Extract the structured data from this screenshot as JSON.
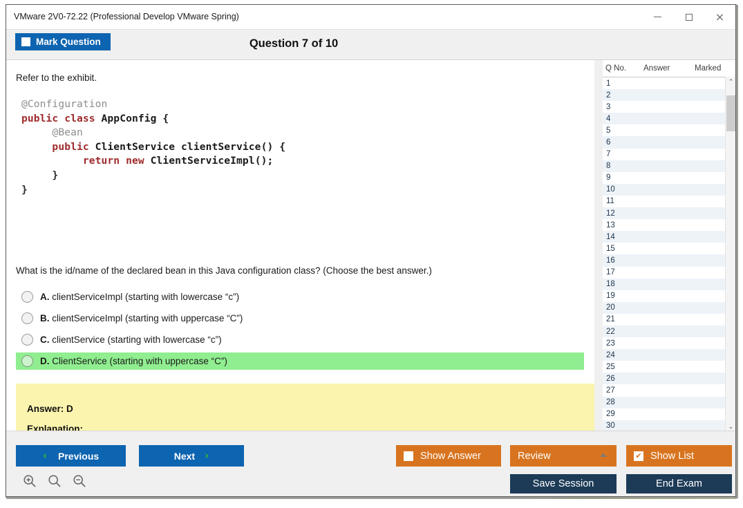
{
  "window": {
    "title": "VMware 2V0-72.22 (Professional Develop VMware Spring)",
    "minimize_label": "Minimize",
    "maximize_label": "Maximize",
    "close_label": "×"
  },
  "header": {
    "mark_question_label": "Mark Question",
    "question_title": "Question 7 of 10"
  },
  "main": {
    "refer_text": "Refer to the exhibit.",
    "exhibit": {
      "lines": [
        "@Configuration",
        "public class AppConfig {",
        "     @Bean",
        "     public ClientService clientService() {",
        "          return new ClientServiceImpl();",
        "     }",
        "}"
      ]
    },
    "prompt": "What is the id/name of the declared bean in this Java configuration class? (Choose the best answer.)",
    "options": [
      {
        "letter": "A.",
        "text": "clientServiceImpl (starting with lowercase “c”)",
        "correct": false
      },
      {
        "letter": "B.",
        "text": "clientServiceImpl (starting with uppercase “C”)",
        "correct": false
      },
      {
        "letter": "C.",
        "text": "clientService (starting with lowercase “c”)",
        "correct": false
      },
      {
        "letter": "D.",
        "text": "ClientService (starting with uppercase “C”)",
        "correct": true
      }
    ],
    "answer_box": {
      "answer_line": "Answer: D",
      "explanation_line": "Explanation:"
    }
  },
  "question_list": {
    "columns": [
      "Q No.",
      "Answer",
      "Marked"
    ],
    "rows": [
      {
        "no": "1",
        "answer": "",
        "marked": ""
      },
      {
        "no": "2",
        "answer": "",
        "marked": ""
      },
      {
        "no": "3",
        "answer": "",
        "marked": ""
      },
      {
        "no": "4",
        "answer": "",
        "marked": ""
      },
      {
        "no": "5",
        "answer": "",
        "marked": ""
      },
      {
        "no": "6",
        "answer": "",
        "marked": ""
      },
      {
        "no": "7",
        "answer": "",
        "marked": ""
      },
      {
        "no": "8",
        "answer": "",
        "marked": ""
      },
      {
        "no": "9",
        "answer": "",
        "marked": ""
      },
      {
        "no": "10",
        "answer": "",
        "marked": ""
      },
      {
        "no": "11",
        "answer": "",
        "marked": ""
      },
      {
        "no": "12",
        "answer": "",
        "marked": ""
      },
      {
        "no": "13",
        "answer": "",
        "marked": ""
      },
      {
        "no": "14",
        "answer": "",
        "marked": ""
      },
      {
        "no": "15",
        "answer": "",
        "marked": ""
      },
      {
        "no": "16",
        "answer": "",
        "marked": ""
      },
      {
        "no": "17",
        "answer": "",
        "marked": ""
      },
      {
        "no": "18",
        "answer": "",
        "marked": ""
      },
      {
        "no": "19",
        "answer": "",
        "marked": ""
      },
      {
        "no": "20",
        "answer": "",
        "marked": ""
      },
      {
        "no": "21",
        "answer": "",
        "marked": ""
      },
      {
        "no": "22",
        "answer": "",
        "marked": ""
      },
      {
        "no": "23",
        "answer": "",
        "marked": ""
      },
      {
        "no": "24",
        "answer": "",
        "marked": ""
      },
      {
        "no": "25",
        "answer": "",
        "marked": ""
      },
      {
        "no": "26",
        "answer": "",
        "marked": ""
      },
      {
        "no": "27",
        "answer": "",
        "marked": ""
      },
      {
        "no": "28",
        "answer": "",
        "marked": ""
      },
      {
        "no": "29",
        "answer": "",
        "marked": ""
      },
      {
        "no": "30",
        "answer": "",
        "marked": ""
      }
    ],
    "scroll_up_glyph": "⌃",
    "scroll_down_glyph": "⌄"
  },
  "footer": {
    "previous_label": "Previous",
    "next_label": "Next",
    "show_answer_label": "Show Answer",
    "review_label": "Review",
    "show_list_label": "Show List",
    "show_list_checked_glyph": "✔",
    "save_session_label": "Save Session",
    "end_exam_label": "End Exam",
    "prev_chevron": "‹",
    "next_chevron": "›",
    "zoom_in_label": "Zoom In",
    "zoom_reset_label": "Zoom Reset",
    "zoom_out_label": "Zoom Out"
  },
  "colors": {
    "accent_blue": "#0d64b0",
    "accent_orange": "#d8741f",
    "navy": "#1d3b57",
    "correct_green": "#90ee90",
    "answer_yellow": "#fbf4ae",
    "chevron_green": "#2fc02f"
  }
}
